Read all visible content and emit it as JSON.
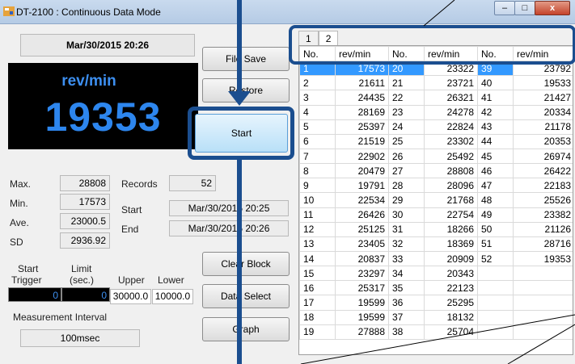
{
  "window": {
    "title": "DT-2100 : Continuous Data Mode",
    "controls": [
      "–",
      "□",
      "x"
    ]
  },
  "datetime": "Mar/30/2015 20:26",
  "display": {
    "unit": "rev/min",
    "value": "19353"
  },
  "stats": {
    "max_label": "Max.",
    "max": "28808",
    "min_label": "Min.",
    "min": "17573",
    "ave_label": "Ave.",
    "ave": "23000.5",
    "sd_label": "SD",
    "sd": "2936.92",
    "records_label": "Records",
    "records": "52",
    "start_label": "Start",
    "start": "Mar/30/2015 20:25",
    "end_label": "End",
    "end": "Mar/30/2015 20:26"
  },
  "trigger": {
    "start_label": "Start",
    "trigger_label": "Trigger",
    "limit_label": "Limit",
    "sec_label": "(sec.)",
    "upper_label": "Upper",
    "lower_label": "Lower",
    "start_value": "0",
    "limit_value": "0",
    "upper_value": "30000.0",
    "lower_value": "10000.0"
  },
  "interval": {
    "label": "Measurement Interval",
    "value": "100msec"
  },
  "buttons": {
    "file_save": "File Save",
    "restore": "Restore",
    "start": "Start",
    "clear_block": "Clear Block",
    "data_select": "Data Select",
    "graph": "Graph"
  },
  "tabs": [
    "1",
    "2"
  ],
  "table": {
    "headers": [
      "No.",
      "rev/min",
      "No.",
      "rev/min",
      "No.",
      "rev/min"
    ],
    "rows": [
      [
        "1",
        "17573",
        "20",
        "23322",
        "39",
        "23792"
      ],
      [
        "2",
        "21611",
        "21",
        "23721",
        "40",
        "19533"
      ],
      [
        "3",
        "24435",
        "22",
        "26321",
        "41",
        "21427"
      ],
      [
        "4",
        "28169",
        "23",
        "24278",
        "42",
        "20334"
      ],
      [
        "5",
        "25397",
        "24",
        "22824",
        "43",
        "21178"
      ],
      [
        "6",
        "21519",
        "25",
        "23302",
        "44",
        "20353"
      ],
      [
        "7",
        "22902",
        "26",
        "25492",
        "45",
        "26974"
      ],
      [
        "8",
        "20479",
        "27",
        "28808",
        "46",
        "26422"
      ],
      [
        "9",
        "19791",
        "28",
        "28096",
        "47",
        "22183"
      ],
      [
        "10",
        "22534",
        "29",
        "21768",
        "48",
        "25526"
      ],
      [
        "11",
        "26426",
        "30",
        "22754",
        "49",
        "23382"
      ],
      [
        "12",
        "25125",
        "31",
        "18266",
        "50",
        "21126"
      ],
      [
        "13",
        "23405",
        "32",
        "18369",
        "51",
        "28716"
      ],
      [
        "14",
        "20837",
        "33",
        "20909",
        "52",
        "19353"
      ],
      [
        "15",
        "23297",
        "34",
        "20343",
        "",
        ""
      ],
      [
        "16",
        "25317",
        "35",
        "22123",
        "",
        ""
      ],
      [
        "17",
        "19599",
        "36",
        "25295",
        "",
        ""
      ],
      [
        "18",
        "19599",
        "37",
        "18132",
        "",
        ""
      ],
      [
        "19",
        "27888",
        "38",
        "25704",
        "",
        ""
      ]
    ]
  },
  "colors": {
    "accent_dark": "#1b4e8f",
    "display_text": "#2d86ee",
    "selection": "#3399ff"
  }
}
